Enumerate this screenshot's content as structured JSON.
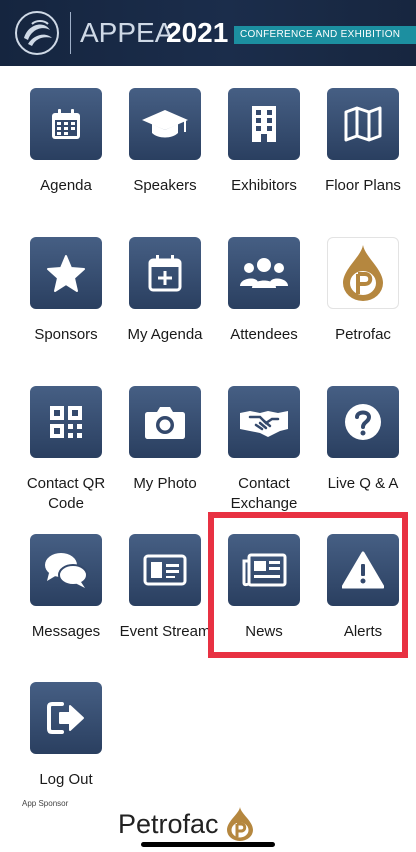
{
  "banner": {
    "title": "APPEA",
    "year": "2021",
    "subtitle": "CONFERENCE AND EXHIBITION"
  },
  "tiles": [
    {
      "label": "Agenda",
      "icon": "calendar-icon"
    },
    {
      "label": "Speakers",
      "icon": "graduation-cap-icon"
    },
    {
      "label": "Exhibitors",
      "icon": "building-icon"
    },
    {
      "label": "Floor Plans",
      "icon": "map-icon"
    },
    {
      "label": "Sponsors",
      "icon": "star-icon"
    },
    {
      "label": "My Agenda",
      "icon": "calendar-plus-icon"
    },
    {
      "label": "Attendees",
      "icon": "users-icon"
    },
    {
      "label": "Petrofac",
      "icon": "petrofac-logo-icon"
    },
    {
      "label": "Contact QR Code",
      "icon": "qr-code-icon"
    },
    {
      "label": "My Photo",
      "icon": "camera-icon"
    },
    {
      "label": "Contact Exchange",
      "icon": "handshake-icon"
    },
    {
      "label": "Live Q & A",
      "icon": "question-icon"
    },
    {
      "label": "Messages",
      "icon": "chat-bubbles-icon"
    },
    {
      "label": "Event Stream",
      "icon": "id-card-icon"
    },
    {
      "label": "News",
      "icon": "newspaper-icon"
    },
    {
      "label": "Alerts",
      "icon": "warning-icon"
    },
    {
      "label": "Log Out",
      "icon": "logout-icon"
    }
  ],
  "footer": {
    "app_sponsor_label": "App Sponsor",
    "sponsor_name": "Petrofac"
  },
  "colors": {
    "banner_bg": "#1b2d4b",
    "tile_gradient_top": "#465f84",
    "tile_gradient_bottom": "#2a3f60",
    "highlight": "#e83142",
    "petrofac_gold": "#b5873f"
  }
}
